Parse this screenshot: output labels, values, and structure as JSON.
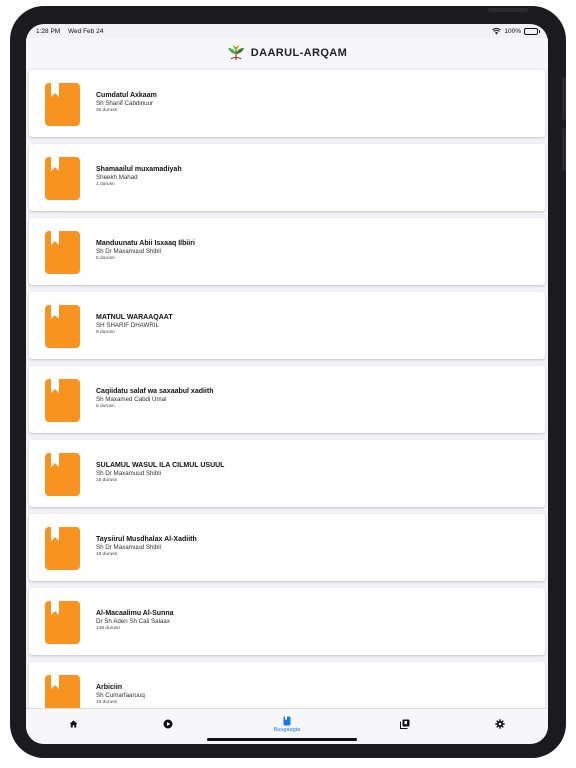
{
  "status_bar": {
    "time": "1:28 PM",
    "date": "Wed Feb 24",
    "battery": "100%"
  },
  "header": {
    "title": "DAARUL-ARQAM",
    "logo_icon": "leaf-logo-icon"
  },
  "book_icon_color": "#f7931e",
  "books": [
    {
      "title": "Cumdatul Axkaam",
      "author": "Sh Shariif Cabdinuur",
      "count": "26 durusn"
    },
    {
      "title": "Shamaailul muxamadiyah",
      "author": "Sheekh Mahad",
      "count": "1 durusn"
    },
    {
      "title": "Manduunatu Abii Isxaaq Ilbiiri",
      "author": "Sh Dr Maxamuud Shibli",
      "count": "5 durusn"
    },
    {
      "title": "MATNUL WARAAQAAT",
      "author": "SH SHARIF DHAWRIL",
      "count": "9 durusn"
    },
    {
      "title": "Caqiidatu salaf wa saxaabul xadiith",
      "author": "Sh Maxamed Cabdi Umal",
      "count": "6 durusn"
    },
    {
      "title": "SULAMUL WASUL ILA CILMUL USUUL",
      "author": "Sh Dr Maxamuud Shibli",
      "count": "16 durusn"
    },
    {
      "title": "Taysiirul Musdhalax Al-Xadiith",
      "author": "Sh Dr Maxamuud Shibli",
      "count": "18 durusn"
    },
    {
      "title": "Al-Macaalimu Al-Sunna",
      "author": "Dr Sh Aden Sh Cali Salaax",
      "count": "148 durusn"
    },
    {
      "title": "Arbiciin",
      "author": "Sh Cumarfaaruuq",
      "count": "10 durusn"
    }
  ],
  "tabs": [
    {
      "name": "home-icon"
    },
    {
      "name": "play-icon"
    },
    {
      "name": "book-icon",
      "label": "Buugaagta",
      "active": true
    },
    {
      "name": "library-icon"
    },
    {
      "name": "gear-icon"
    }
  ],
  "accent_color": "#1a7cf5"
}
